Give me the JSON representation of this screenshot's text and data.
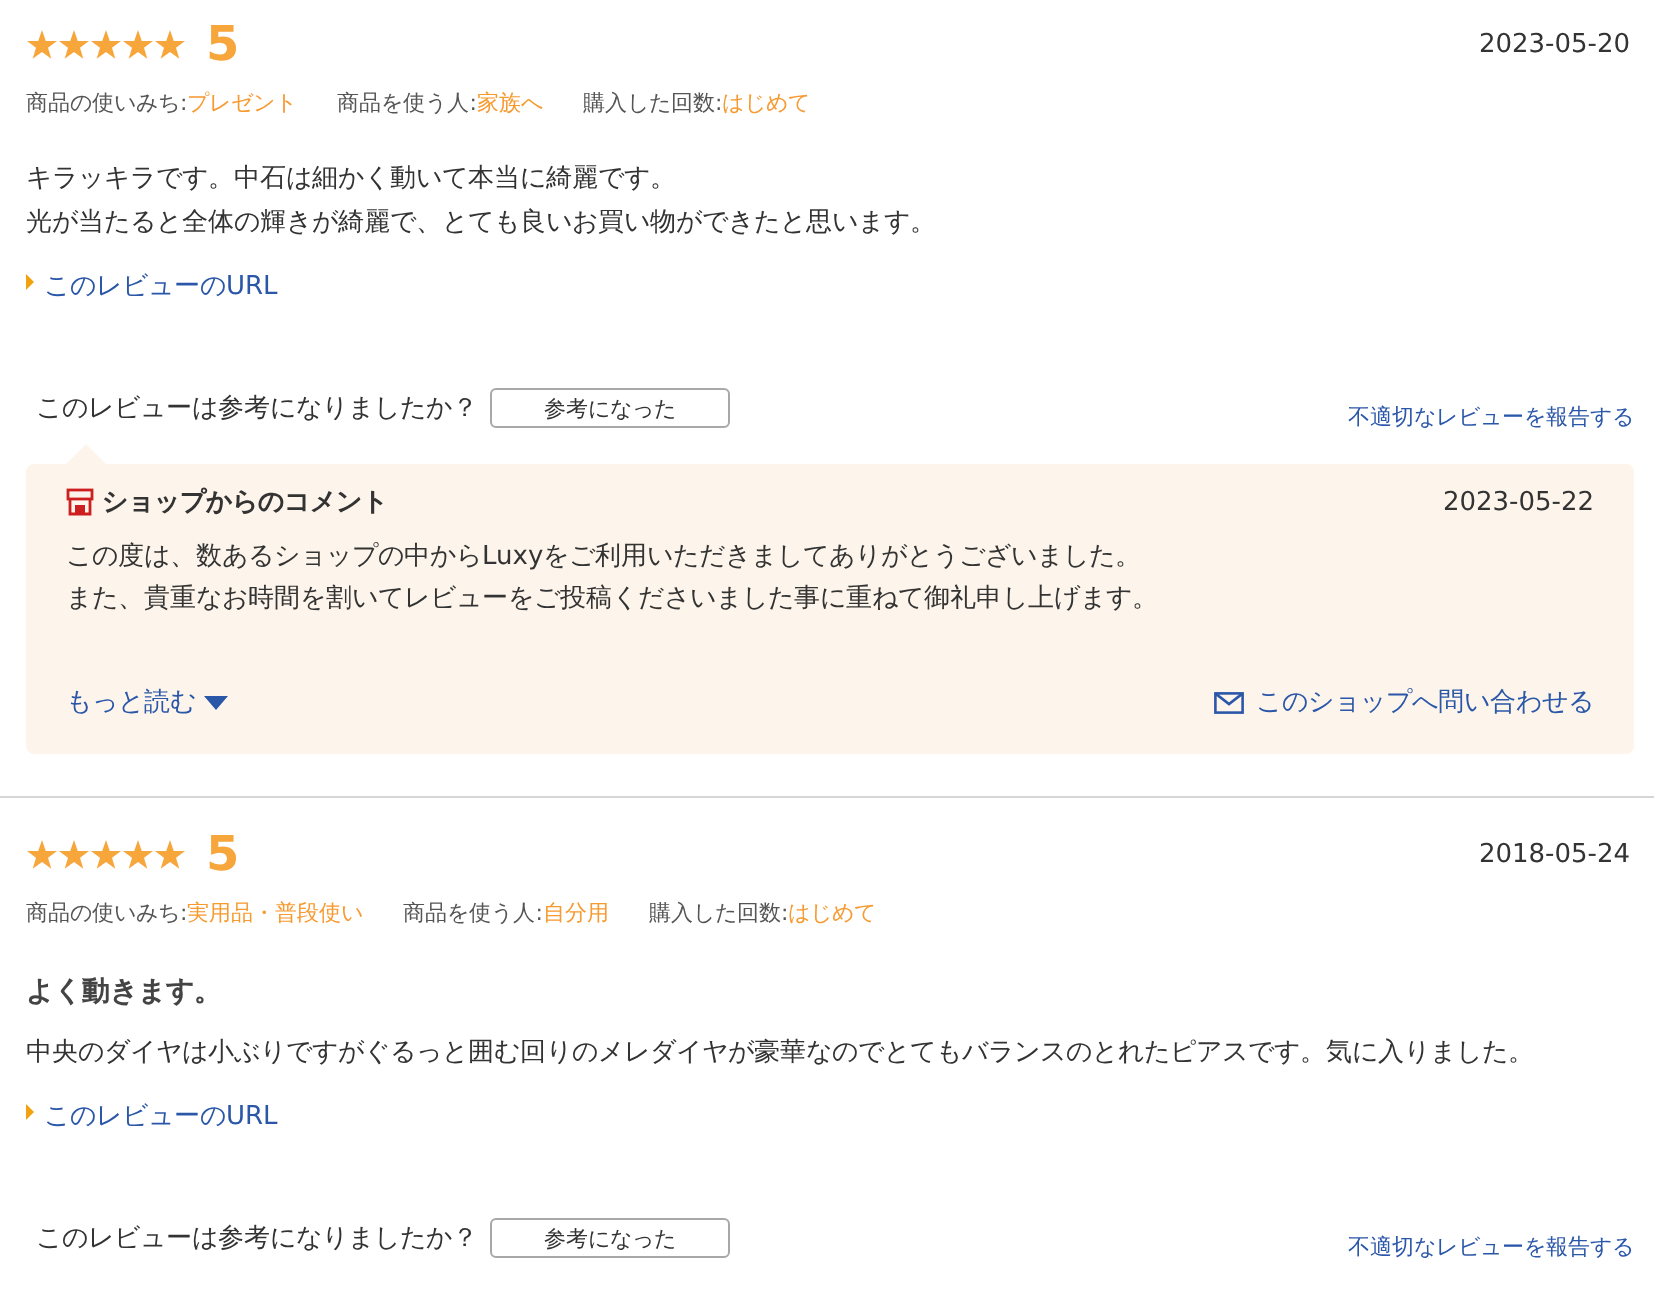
{
  "reviews": [
    {
      "stars": 5,
      "score": "5",
      "date": "2023-05-20",
      "attributes": [
        {
          "label": "商品の使いみち:",
          "value": "プレゼント"
        },
        {
          "label": "商品を使う人:",
          "value": "家族へ"
        },
        {
          "label": "購入した回数:",
          "value": "はじめて"
        }
      ],
      "body_lines": [
        "キラッキラです。中石は細かく動いて本当に綺麗です。",
        "光が当たると全体の輝きが綺麗で、とても良いお買い物ができたと思います。"
      ],
      "url_link": "このレビューのURL",
      "helpful_question": "このレビューは参考になりましたか？",
      "helpful_button": "参考になった",
      "report_link": "不適切なレビューを報告する",
      "shop_comment": {
        "title": "ショップからのコメント",
        "date": "2023-05-22",
        "body_lines": [
          "この度は、数あるショップの中からLuxyをご利用いただきましてありがとうございました。",
          "また、貴重なお時間を割いてレビューをご投稿くださいました事に重ねて御礼申し上げます。"
        ],
        "read_more": "もっと読む",
        "contact_link": "このショップへ問い合わせる"
      }
    },
    {
      "stars": 5,
      "score": "5",
      "date": "2018-05-24",
      "attributes": [
        {
          "label": "商品の使いみち:",
          "value": "実用品・普段使い"
        },
        {
          "label": "商品を使う人:",
          "value": "自分用"
        },
        {
          "label": "購入した回数:",
          "value": "はじめて"
        }
      ],
      "title": "よく動きます。",
      "body_lines": [
        "中央のダイヤは小ぶりですがぐるっと囲む回りのメレダイヤが豪華なのでとてもバランスのとれたピアスです。気に入りました。"
      ],
      "url_link": "このレビューのURL",
      "helpful_question": "このレビューは参考になりましたか？",
      "helpful_button": "参考になった",
      "report_link": "不適切なレビューを報告する"
    }
  ]
}
